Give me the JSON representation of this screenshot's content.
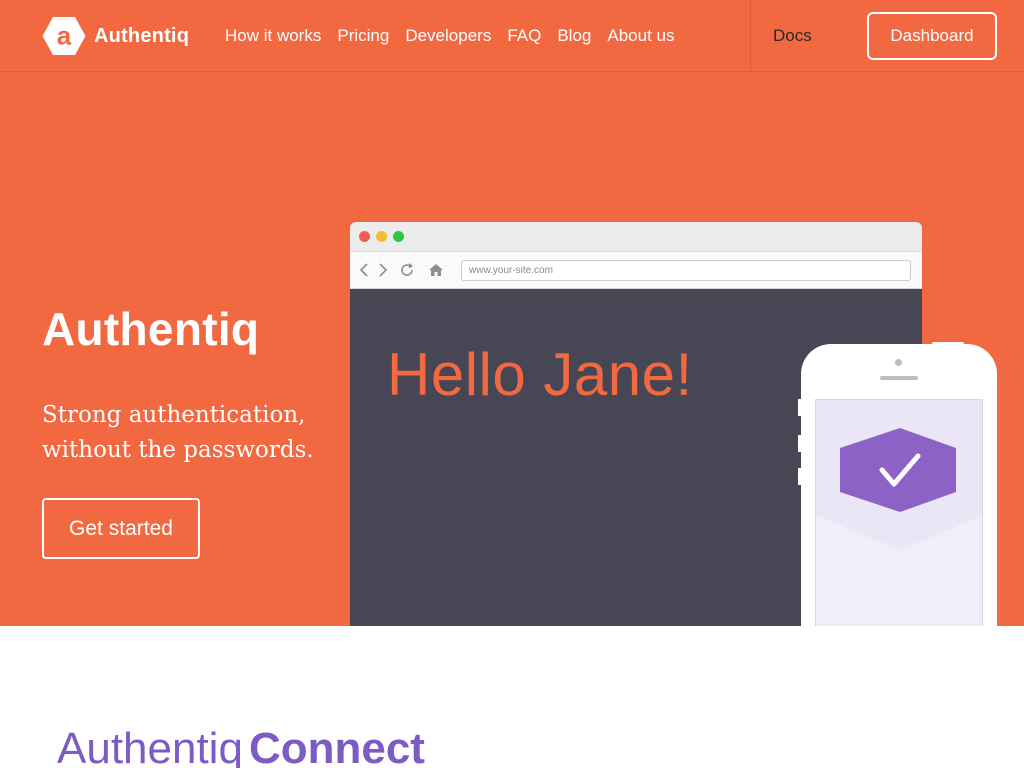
{
  "brand": {
    "name": "Authentiq",
    "logo_letter": "a"
  },
  "nav": {
    "links": [
      "How it works",
      "Pricing",
      "Developers",
      "FAQ",
      "Blog",
      "About us"
    ],
    "docs": "Docs",
    "dashboard": "Dashboard"
  },
  "hero": {
    "title": "Authentiq",
    "subtitle_line1": "Strong authentication,",
    "subtitle_line2": "without the passwords.",
    "cta": "Get started"
  },
  "browser_mock": {
    "url": "www.your-site.com",
    "greeting": "Hello Jane!",
    "toolbar_icons": [
      "back-icon",
      "forward-icon",
      "reload-icon",
      "home-icon"
    ]
  },
  "phone_mock": {
    "badge_icon": "checkmark-icon"
  },
  "section": {
    "heading_light": "Authentiq",
    "heading_bold": "Connect"
  },
  "colors": {
    "brand_orange": "#f26841",
    "purple_accent": "#7c5bc4",
    "badge_purple": "#8c62c6",
    "browser_body": "#474655",
    "white": "#ffffff"
  }
}
